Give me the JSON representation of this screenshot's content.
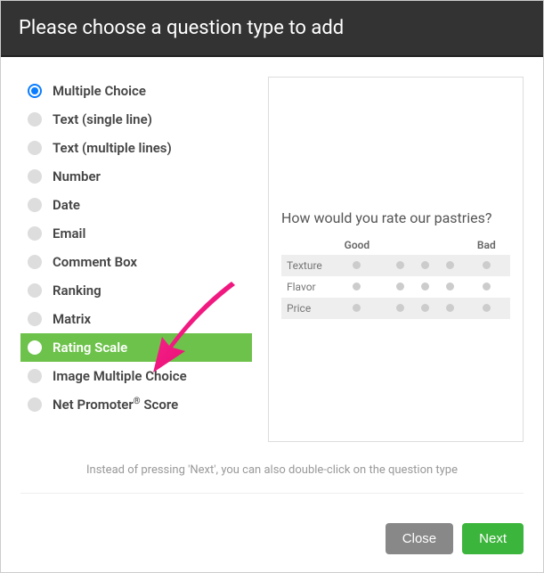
{
  "header": {
    "title": "Please choose a question type to add"
  },
  "questions": [
    {
      "label": "Multiple Choice",
      "selected": true,
      "highlighted": false
    },
    {
      "label": "Text (single line)",
      "selected": false,
      "highlighted": false
    },
    {
      "label": "Text (multiple lines)",
      "selected": false,
      "highlighted": false
    },
    {
      "label": "Number",
      "selected": false,
      "highlighted": false
    },
    {
      "label": "Date",
      "selected": false,
      "highlighted": false
    },
    {
      "label": "Email",
      "selected": false,
      "highlighted": false
    },
    {
      "label": "Comment Box",
      "selected": false,
      "highlighted": false
    },
    {
      "label": "Ranking",
      "selected": false,
      "highlighted": false
    },
    {
      "label": "Matrix",
      "selected": false,
      "highlighted": false
    },
    {
      "label": "Rating Scale",
      "selected": false,
      "highlighted": true
    },
    {
      "label": "Image Multiple Choice",
      "selected": false,
      "highlighted": false
    },
    {
      "label": "Net Promoter® Score",
      "selected": false,
      "highlighted": false
    }
  ],
  "preview": {
    "title": "How would you rate our pastries?",
    "scale": {
      "left": "Good",
      "right": "Bad"
    },
    "rows": [
      "Texture",
      "Flavor",
      "Price"
    ],
    "cols": 5
  },
  "hint": "Instead of pressing 'Next', you can also double-click on the question type",
  "footer": {
    "close": "Close",
    "next": "Next"
  }
}
